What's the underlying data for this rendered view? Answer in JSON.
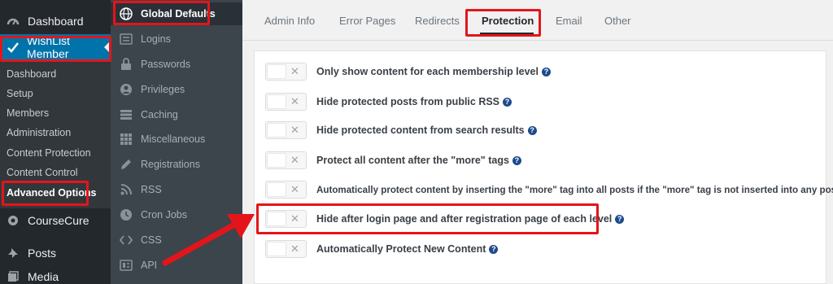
{
  "wp_menu": {
    "dashboard": "Dashboard",
    "wishlist_member": "WishList Member",
    "submenu": [
      "Dashboard",
      "Setup",
      "Members",
      "Administration",
      "Content Protection",
      "Content Control",
      "Advanced Options"
    ],
    "coursecure": "CourseCure",
    "posts": "Posts",
    "media": "Media"
  },
  "plugin_nav": {
    "items": [
      {
        "label": "Global Defaults",
        "icon": "globe-icon"
      },
      {
        "label": "Logins",
        "icon": "login-icon"
      },
      {
        "label": "Passwords",
        "icon": "lock-icon"
      },
      {
        "label": "Privileges",
        "icon": "user-icon"
      },
      {
        "label": "Caching",
        "icon": "database-icon"
      },
      {
        "label": "Miscellaneous",
        "icon": "grid-icon"
      },
      {
        "label": "Registrations",
        "icon": "pencil-icon"
      },
      {
        "label": "RSS",
        "icon": "rss-icon"
      },
      {
        "label": "Cron Jobs",
        "icon": "clock-icon"
      },
      {
        "label": "CSS",
        "icon": "code-icon"
      },
      {
        "label": "API",
        "icon": "api-icon"
      }
    ]
  },
  "tabs": [
    "Admin Info",
    "Error Pages",
    "Redirects",
    "Protection",
    "Email",
    "Other"
  ],
  "active_tab": "Protection",
  "options": [
    {
      "label": "Only show content for each membership level",
      "enabled": false
    },
    {
      "label": "Hide protected posts from public RSS",
      "enabled": false
    },
    {
      "label": "Hide protected content from search results",
      "enabled": false
    },
    {
      "label": "Protect all content after the \"more\" tags",
      "enabled": false
    },
    {
      "label": "Automatically protect content by inserting the \"more\" tag into all posts if the \"more\" tag is not inserted into any post",
      "enabled": false
    },
    {
      "label": "Hide after login page and after registration page of each level",
      "enabled": false
    },
    {
      "label": "Automatically Protect New Content",
      "enabled": false
    }
  ],
  "help_glyph": "?",
  "toggle_glyph": "✕",
  "colors": {
    "highlight": "#e3151a",
    "wp_active": "#0073aa",
    "help": "#1c4b8c"
  }
}
